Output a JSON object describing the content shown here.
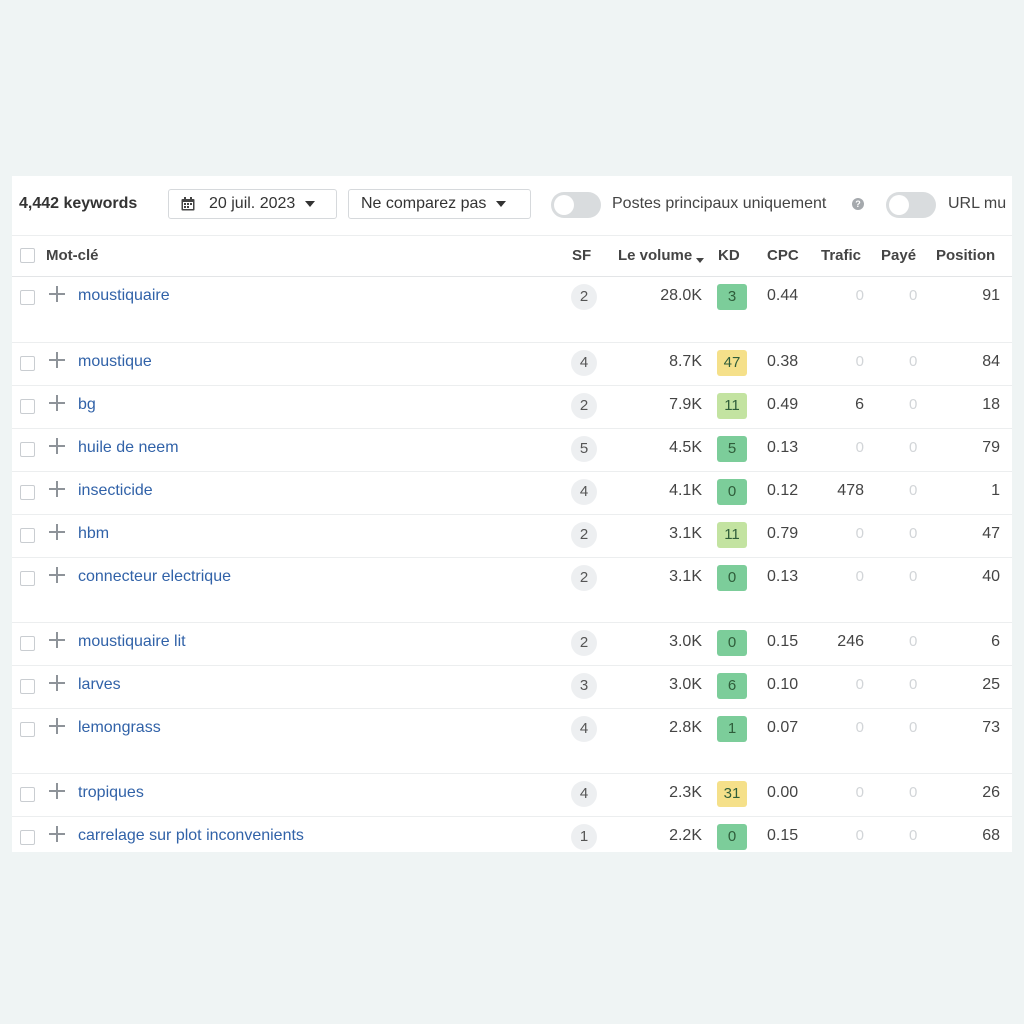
{
  "toolbar": {
    "keyword_count": "4,442 keywords",
    "date_label": "20 juil. 2023",
    "compare_label": "Ne comparez pas",
    "toggle_main_label": "Postes principaux uniquement",
    "toggle_url_label": "URL mu",
    "help_glyph": "?"
  },
  "columns": {
    "keyword": "Mot-clé",
    "sf": "SF",
    "volume": "Le volume",
    "kd": "KD",
    "cpc": "CPC",
    "traffic": "Trafic",
    "paid": "Payé",
    "position": "Position"
  },
  "kd_colors": {
    "easy": "#7ccd9a",
    "medium": "#c3e3a1",
    "hard": "#f5e08a"
  },
  "rows": [
    {
      "keyword": "moustiquaire",
      "sf": "2",
      "volume": "28.0K",
      "kd": "3",
      "kd_level": "easy",
      "cpc": "0.44",
      "traffic": "0",
      "paid": "0",
      "position": "91"
    },
    {
      "keyword": "moustique",
      "sf": "4",
      "volume": "8.7K",
      "kd": "47",
      "kd_level": "hard",
      "cpc": "0.38",
      "traffic": "0",
      "paid": "0",
      "position": "84"
    },
    {
      "keyword": "bg",
      "sf": "2",
      "volume": "7.9K",
      "kd": "11",
      "kd_level": "medium",
      "cpc": "0.49",
      "traffic": "6",
      "paid": "0",
      "position": "18"
    },
    {
      "keyword": "huile de neem",
      "sf": "5",
      "volume": "4.5K",
      "kd": "5",
      "kd_level": "easy",
      "cpc": "0.13",
      "traffic": "0",
      "paid": "0",
      "position": "79"
    },
    {
      "keyword": "insecticide",
      "sf": "4",
      "volume": "4.1K",
      "kd": "0",
      "kd_level": "easy",
      "cpc": "0.12",
      "traffic": "478",
      "paid": "0",
      "position": "1"
    },
    {
      "keyword": "hbm",
      "sf": "2",
      "volume": "3.1K",
      "kd": "11",
      "kd_level": "medium",
      "cpc": "0.79",
      "traffic": "0",
      "paid": "0",
      "position": "47"
    },
    {
      "keyword": "connecteur electrique",
      "sf": "2",
      "volume": "3.1K",
      "kd": "0",
      "kd_level": "easy",
      "cpc": "0.13",
      "traffic": "0",
      "paid": "0",
      "position": "40"
    },
    {
      "keyword": "moustiquaire lit",
      "sf": "2",
      "volume": "3.0K",
      "kd": "0",
      "kd_level": "easy",
      "cpc": "0.15",
      "traffic": "246",
      "paid": "0",
      "position": "6"
    },
    {
      "keyword": "larves",
      "sf": "3",
      "volume": "3.0K",
      "kd": "6",
      "kd_level": "easy",
      "cpc": "0.10",
      "traffic": "0",
      "paid": "0",
      "position": "25"
    },
    {
      "keyword": "lemongrass",
      "sf": "4",
      "volume": "2.8K",
      "kd": "1",
      "kd_level": "easy",
      "cpc": "0.07",
      "traffic": "0",
      "paid": "0",
      "position": "73"
    },
    {
      "keyword": "tropiques",
      "sf": "4",
      "volume": "2.3K",
      "kd": "31",
      "kd_level": "hard",
      "cpc": "0.00",
      "traffic": "0",
      "paid": "0",
      "position": "26"
    },
    {
      "keyword": "carrelage sur plot inconvenients",
      "sf": "1",
      "volume": "2.2K",
      "kd": "0",
      "kd_level": "easy",
      "cpc": "0.15",
      "traffic": "0",
      "paid": "0",
      "position": "68"
    }
  ]
}
